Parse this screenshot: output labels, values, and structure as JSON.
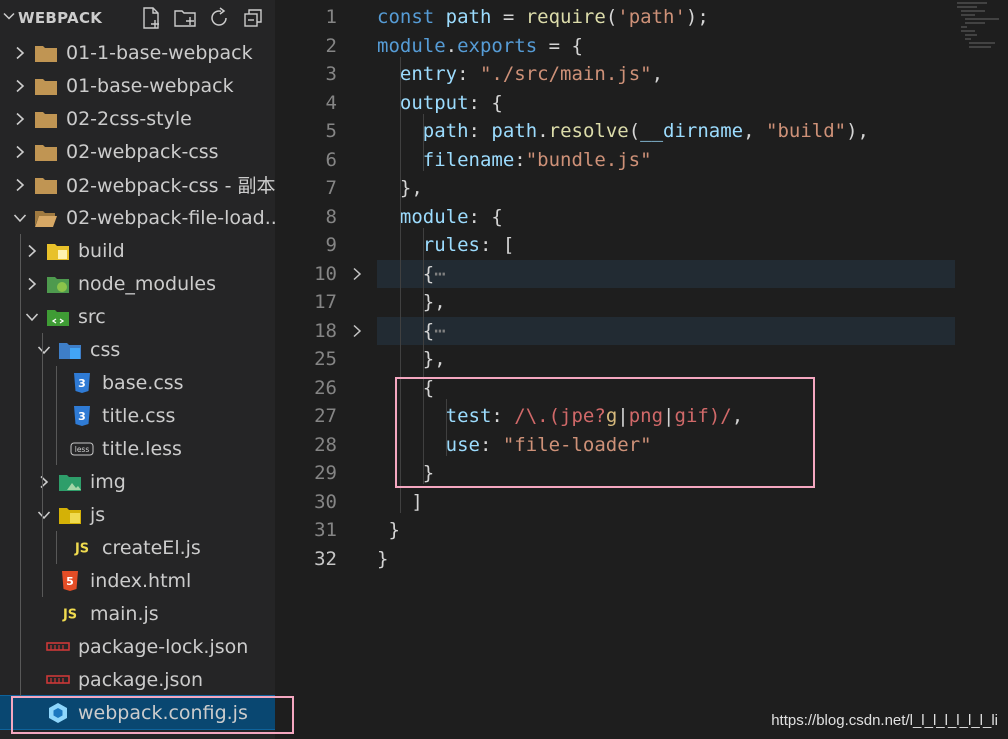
{
  "explorer": {
    "title": "WEBPACK",
    "actions": [
      {
        "name": "new-file-icon"
      },
      {
        "name": "new-folder-icon"
      },
      {
        "name": "refresh-icon"
      },
      {
        "name": "collapse-all-icon"
      }
    ],
    "items": [
      {
        "label": "01-1-base-webpack",
        "depth": 0,
        "kind": "folder",
        "chevron": "right"
      },
      {
        "label": "01-base-webpack",
        "depth": 0,
        "kind": "folder",
        "chevron": "right"
      },
      {
        "label": "02-2css-style",
        "depth": 0,
        "kind": "folder",
        "chevron": "right"
      },
      {
        "label": "02-webpack-css",
        "depth": 0,
        "kind": "folder",
        "chevron": "right"
      },
      {
        "label": "02-webpack-css - 副本",
        "depth": 0,
        "kind": "folder",
        "chevron": "right"
      },
      {
        "label": "02-webpack-file-load...",
        "depth": 0,
        "kind": "folder-open",
        "chevron": "down"
      },
      {
        "label": "build",
        "depth": 1,
        "kind": "folder-build",
        "chevron": "right"
      },
      {
        "label": "node_modules",
        "depth": 1,
        "kind": "folder-node",
        "chevron": "right"
      },
      {
        "label": "src",
        "depth": 1,
        "kind": "folder-src",
        "chevron": "down"
      },
      {
        "label": "css",
        "depth": 2,
        "kind": "folder-css",
        "chevron": "down"
      },
      {
        "label": "base.css",
        "depth": 3,
        "kind": "css",
        "chevron": ""
      },
      {
        "label": "title.css",
        "depth": 3,
        "kind": "css",
        "chevron": ""
      },
      {
        "label": "title.less",
        "depth": 3,
        "kind": "less",
        "chevron": ""
      },
      {
        "label": "img",
        "depth": 2,
        "kind": "folder-img",
        "chevron": "right"
      },
      {
        "label": "js",
        "depth": 2,
        "kind": "folder-js",
        "chevron": "down"
      },
      {
        "label": "createEl.js",
        "depth": 3,
        "kind": "js",
        "chevron": ""
      },
      {
        "label": "index.html",
        "depth": 2,
        "kind": "html",
        "chevron": ""
      },
      {
        "label": "main.js",
        "depth": 2,
        "kind": "js",
        "chevron": ""
      },
      {
        "label": "package-lock.json",
        "depth": 1,
        "kind": "npm",
        "chevron": ""
      },
      {
        "label": "package.json",
        "depth": 1,
        "kind": "npm",
        "chevron": ""
      },
      {
        "label": "webpack.config.js",
        "depth": 1,
        "kind": "webpack",
        "chevron": "",
        "selected": true
      }
    ],
    "icon_labels": {
      "js": "JS",
      "css": "3",
      "less": "less",
      "html": "5"
    }
  },
  "editor": {
    "lines": [
      {
        "n": "1",
        "tokens": [
          [
            "kw",
            "const "
          ],
          [
            "var",
            "path"
          ],
          [
            "pun",
            " = "
          ],
          [
            "fn",
            "require"
          ],
          [
            "pun",
            "("
          ],
          [
            "str",
            "'path'"
          ],
          [
            "pun",
            ");"
          ]
        ]
      },
      {
        "n": "2",
        "tokens": [
          [
            "kw",
            "module"
          ],
          [
            "pun",
            "."
          ],
          [
            "kw",
            "exports"
          ],
          [
            "pun",
            " = {"
          ]
        ]
      },
      {
        "n": "3",
        "tokens": [
          [
            "pun",
            "  "
          ],
          [
            "var",
            "entry"
          ],
          [
            "pun",
            ": "
          ],
          [
            "str",
            "\"./src/main.js\""
          ],
          [
            "pun",
            ","
          ]
        ]
      },
      {
        "n": "4",
        "tokens": [
          [
            "pun",
            "  "
          ],
          [
            "var",
            "output"
          ],
          [
            "pun",
            ": {"
          ]
        ]
      },
      {
        "n": "5",
        "tokens": [
          [
            "pun",
            "    "
          ],
          [
            "var",
            "path"
          ],
          [
            "pun",
            ": "
          ],
          [
            "var",
            "path"
          ],
          [
            "pun",
            "."
          ],
          [
            "fn",
            "resolve"
          ],
          [
            "pun",
            "("
          ],
          [
            "var",
            "__dirname"
          ],
          [
            "pun",
            ", "
          ],
          [
            "str",
            "\"build\""
          ],
          [
            "pun",
            "),"
          ]
        ]
      },
      {
        "n": "6",
        "tokens": [
          [
            "pun",
            "    "
          ],
          [
            "var",
            "filename"
          ],
          [
            "pun",
            ":"
          ],
          [
            "str",
            "\"bundle.js\""
          ]
        ]
      },
      {
        "n": "7",
        "tokens": [
          [
            "pun",
            "  },"
          ]
        ]
      },
      {
        "n": "8",
        "tokens": [
          [
            "pun",
            "  "
          ],
          [
            "var",
            "module"
          ],
          [
            "pun",
            ": {"
          ]
        ]
      },
      {
        "n": "9",
        "tokens": [
          [
            "pun",
            "    "
          ],
          [
            "var",
            "rules"
          ],
          [
            "pun",
            ": ["
          ]
        ]
      },
      {
        "n": "10",
        "fold": true,
        "tokens": [
          [
            "pun",
            "    {"
          ],
          [
            "fold-dots",
            "⋯"
          ]
        ]
      },
      {
        "n": "17",
        "tokens": [
          [
            "pun",
            "    },"
          ]
        ]
      },
      {
        "n": "18",
        "fold": true,
        "tokens": [
          [
            "pun",
            "    {"
          ],
          [
            "fold-dots",
            "⋯"
          ]
        ]
      },
      {
        "n": "25",
        "tokens": [
          [
            "pun",
            "    },"
          ]
        ]
      },
      {
        "n": "26",
        "tokens": [
          [
            "pun",
            "    {"
          ]
        ]
      },
      {
        "n": "27",
        "tokens": [
          [
            "pun",
            "      "
          ],
          [
            "var",
            "test"
          ],
          [
            "pun",
            ": "
          ],
          [
            "rx",
            "/\\.(jpe?"
          ],
          [
            "rxc",
            "g"
          ],
          [
            "pun",
            "|"
          ],
          [
            "rx",
            "png"
          ],
          [
            "pun",
            "|"
          ],
          [
            "rx",
            "gif)/"
          ],
          [
            "pun",
            ","
          ]
        ]
      },
      {
        "n": "28",
        "tokens": [
          [
            "pun",
            "      "
          ],
          [
            "var",
            "use"
          ],
          [
            "pun",
            ": "
          ],
          [
            "str",
            "\"file-loader\""
          ]
        ]
      },
      {
        "n": "29",
        "tokens": [
          [
            "pun",
            "    }"
          ]
        ]
      },
      {
        "n": "30",
        "tokens": [
          [
            "pun",
            "   ]"
          ]
        ]
      },
      {
        "n": "31",
        "tokens": [
          [
            "pun",
            " }"
          ]
        ]
      },
      {
        "n": "32",
        "active": true,
        "tokens": [
          [
            "pun",
            "}"
          ]
        ]
      }
    ]
  },
  "watermark": "https://blog.csdn.net/l_l_l_l_l_l_l_li"
}
